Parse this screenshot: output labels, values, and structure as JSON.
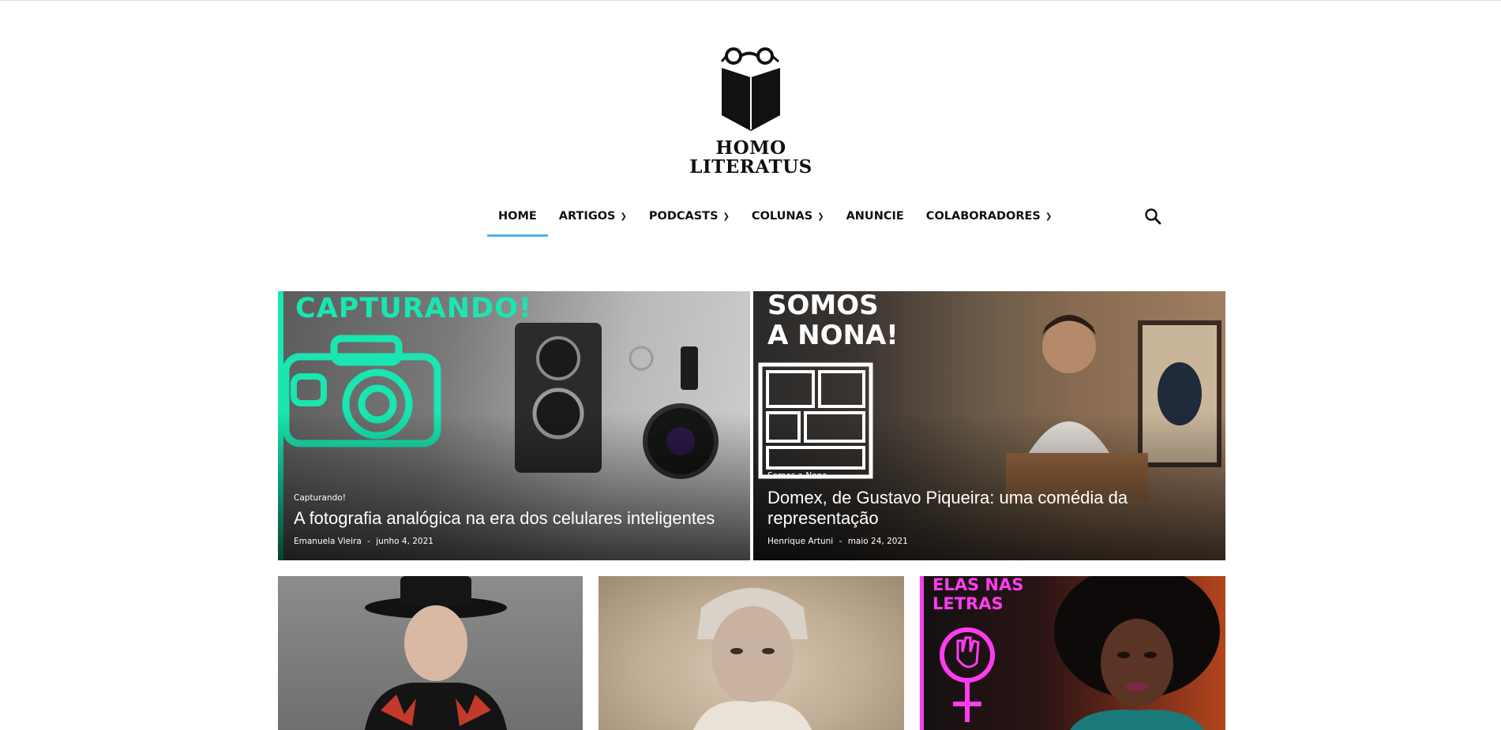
{
  "site": {
    "logo_line1": "HOMO",
    "logo_line2": "LITERATUS"
  },
  "nav": {
    "items": [
      {
        "label": "HOME",
        "active": true,
        "dropdown": false
      },
      {
        "label": "ARTIGOS",
        "active": false,
        "dropdown": true
      },
      {
        "label": "PODCASTS",
        "active": false,
        "dropdown": true
      },
      {
        "label": "COLUNAS",
        "active": false,
        "dropdown": true
      },
      {
        "label": "ANUNCIE",
        "active": false,
        "dropdown": false
      },
      {
        "label": "COLABORADORES",
        "active": false,
        "dropdown": true
      }
    ],
    "search_icon": "search-icon",
    "accent_color": "#4db2ec"
  },
  "featured": [
    {
      "image_text": "CAPTURANDO!",
      "category": "Capturando!",
      "title": "A fotografia analógica na era dos celulares inteligentes",
      "author": "Emanuela Vieira",
      "date": "junho 4, 2021",
      "accent_color": "#19e6b0"
    },
    {
      "image_text_1": "SOMOS",
      "image_text_2": "A NONA!",
      "category": "Somos a Nona",
      "title": "Domex, de Gustavo Piqueira: uma comédia da representação",
      "author": "Henrique Artuni",
      "date": "maio 24, 2021"
    }
  ],
  "secondary": [
    {},
    {},
    {
      "image_text_1": "ELAS NAS",
      "image_text_2": "LETRAS",
      "accent_color": "#ff3cf0"
    }
  ],
  "meta_separator": "-"
}
